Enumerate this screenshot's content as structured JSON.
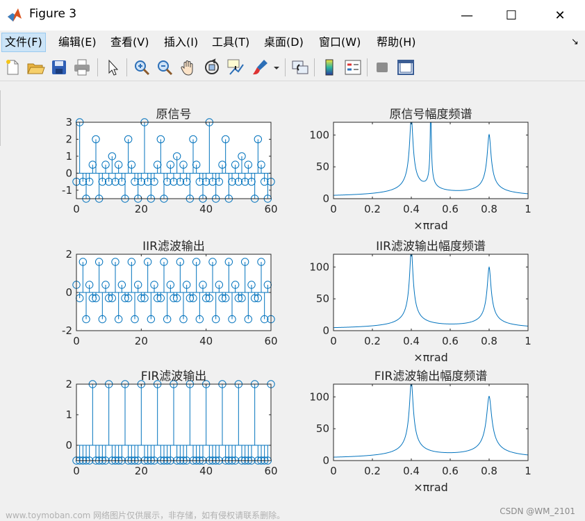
{
  "window": {
    "title": "Figure 3",
    "controls": {
      "minimize": "—",
      "maximize": "☐",
      "close": "✕"
    }
  },
  "menu": [
    {
      "label": "文件(F)",
      "active": true
    },
    {
      "label": "编辑(E)"
    },
    {
      "label": "查看(V)"
    },
    {
      "label": "插入(I)"
    },
    {
      "label": "工具(T)"
    },
    {
      "label": "桌面(D)"
    },
    {
      "label": "窗口(W)"
    },
    {
      "label": "帮助(H)"
    }
  ],
  "menu_dock_glyph": "↘",
  "toolbar": [
    "new-figure-icon",
    "open-file-icon",
    "save-icon",
    "print-icon",
    "pointer-icon",
    "zoom-in-icon",
    "zoom-out-icon",
    "pan-hand-icon",
    "rotate-3d-icon",
    "data-cursor-icon",
    "brush-icon",
    "link-plot-icon",
    "colorbar-icon",
    "legend-icon",
    "hide-plot-tools-icon",
    "show-plot-tools-icon"
  ],
  "colors": {
    "line": "#0072bd",
    "axes": "#262626",
    "plot_bg": "#ffffff",
    "figure_bg": "#f0f0f0"
  },
  "chart_data": [
    {
      "type": "stem",
      "title": "原信号",
      "xlabel": "",
      "ylabel": "",
      "xlim": [
        0,
        60
      ],
      "ylim": [
        -1.5,
        3
      ],
      "xticks": [
        0,
        20,
        40,
        60
      ],
      "yticks": [
        -1,
        0,
        1,
        2,
        3
      ],
      "x": [
        0,
        1,
        2,
        3,
        4,
        5,
        6,
        7,
        8,
        9,
        10,
        11,
        12,
        13,
        14,
        15,
        16,
        17,
        18,
        19,
        20,
        21,
        22,
        23,
        24,
        25,
        26,
        27,
        28,
        29,
        30,
        31,
        32,
        33,
        34,
        35,
        36,
        37,
        38,
        39,
        40,
        41,
        42,
        43,
        44,
        45,
        46,
        47,
        48,
        49,
        50,
        51,
        52,
        53,
        54,
        55,
        56,
        57,
        58,
        59,
        60
      ],
      "values": [
        -0.5,
        3,
        -0.5,
        -1.5,
        -0.5,
        0.5,
        2,
        -1.5,
        -0.5,
        0.5,
        -0.5,
        1,
        -0.5,
        0.5,
        -0.5,
        -1.5,
        2,
        0.5,
        -0.5,
        -1.5,
        -0.5,
        3,
        -0.5,
        -1.5,
        -0.5,
        0.5,
        2,
        -1.5,
        -0.5,
        0.5,
        -0.5,
        1,
        -0.5,
        0.5,
        -0.5,
        -1.5,
        2,
        0.5,
        -0.5,
        -1.5,
        -0.5,
        3,
        -0.5,
        -1.5,
        -0.5,
        0.5,
        2,
        -1.5,
        -0.5,
        0.5,
        -0.5,
        1,
        -0.5,
        0.5,
        -0.5,
        -1.5,
        2,
        0.5,
        -0.5,
        -1.5,
        -0.5
      ]
    },
    {
      "type": "line",
      "title": "原信号幅度频谱",
      "xlabel": "×πrad",
      "ylabel": "",
      "xlim": [
        0,
        1
      ],
      "ylim": [
        0,
        120
      ],
      "xticks": [
        0,
        0.2,
        0.4,
        0.6,
        0.8,
        1
      ],
      "yticks": [
        0,
        50,
        100
      ],
      "peaks": [
        {
          "x": 0.4,
          "y": 122,
          "width": 0.008
        },
        {
          "x": 0.5,
          "y": 150,
          "width": 0.002
        },
        {
          "x": 0.8,
          "y": 96,
          "width": 0.009
        }
      ]
    },
    {
      "type": "stem",
      "title": "IIR滤波输出",
      "xlabel": "",
      "ylabel": "",
      "xlim": [
        0,
        60
      ],
      "ylim": [
        -2,
        2
      ],
      "xticks": [
        0,
        20,
        40,
        60
      ],
      "yticks": [
        -2,
        0,
        2
      ],
      "x": [
        0,
        1,
        2,
        3,
        4,
        5,
        6,
        7,
        8,
        9,
        10,
        11,
        12,
        13,
        14,
        15,
        16,
        17,
        18,
        19,
        20,
        21,
        22,
        23,
        24,
        25,
        26,
        27,
        28,
        29,
        30,
        31,
        32,
        33,
        34,
        35,
        36,
        37,
        38,
        39,
        40,
        41,
        42,
        43,
        44,
        45,
        46,
        47,
        48,
        49,
        50,
        51,
        52,
        53,
        54,
        55,
        56,
        57,
        58,
        59,
        60
      ],
      "values": [
        0.4,
        -0.3,
        1.6,
        -1.4,
        0.4,
        -0.3,
        -0.3,
        1.6,
        -1.4,
        0.4,
        -0.3,
        -0.3,
        1.6,
        -1.4,
        0.4,
        -0.3,
        -0.3,
        1.6,
        -1.4,
        0.4,
        -0.3,
        -0.3,
        1.6,
        -1.4,
        0.4,
        -0.3,
        -0.3,
        1.6,
        -1.4,
        0.4,
        -0.3,
        -0.3,
        1.6,
        -1.4,
        0.4,
        -0.3,
        -0.3,
        1.6,
        -1.4,
        0.4,
        -0.3,
        -0.3,
        1.6,
        -1.4,
        0.4,
        -0.3,
        -0.3,
        1.6,
        -1.4,
        0.4,
        -0.3,
        -0.3,
        1.6,
        -1.4,
        0.4,
        -0.3,
        -0.3,
        1.6,
        -1.4,
        0.4,
        -1.4
      ]
    },
    {
      "type": "line",
      "title": "IIR滤波输出幅度频谱",
      "xlabel": "×πrad",
      "ylabel": "",
      "xlim": [
        0,
        1
      ],
      "ylim": [
        0,
        120
      ],
      "xticks": [
        0,
        0.2,
        0.4,
        0.6,
        0.8,
        1
      ],
      "yticks": [
        0,
        50,
        100
      ],
      "peaks": [
        {
          "x": 0.4,
          "y": 125,
          "width": 0.008
        },
        {
          "x": 0.8,
          "y": 96,
          "width": 0.009
        }
      ]
    },
    {
      "type": "stem",
      "title": "FIR滤波输出",
      "xlabel": "",
      "ylabel": "",
      "xlim": [
        0,
        60
      ],
      "ylim": [
        -0.5,
        2
      ],
      "xticks": [
        0,
        20,
        40,
        60
      ],
      "yticks": [
        0,
        1,
        2
      ],
      "x": [
        0,
        1,
        2,
        3,
        4,
        5,
        6,
        7,
        8,
        9,
        10,
        11,
        12,
        13,
        14,
        15,
        16,
        17,
        18,
        19,
        20,
        21,
        22,
        23,
        24,
        25,
        26,
        27,
        28,
        29,
        30,
        31,
        32,
        33,
        34,
        35,
        36,
        37,
        38,
        39,
        40,
        41,
        42,
        43,
        44,
        45,
        46,
        47,
        48,
        49,
        50,
        51,
        52,
        53,
        54,
        55,
        56,
        57,
        58,
        59,
        60
      ],
      "values": [
        -0.5,
        -0.5,
        -0.5,
        -0.5,
        -0.5,
        2,
        -0.5,
        -0.5,
        -0.5,
        -0.5,
        2,
        -0.5,
        -0.5,
        -0.5,
        -0.5,
        2,
        -0.5,
        -0.5,
        -0.5,
        -0.5,
        2,
        -0.5,
        -0.5,
        -0.5,
        -0.5,
        2,
        -0.5,
        -0.5,
        -0.5,
        -0.5,
        2,
        -0.5,
        -0.5,
        -0.5,
        -0.5,
        2,
        -0.5,
        -0.5,
        -0.5,
        -0.5,
        2,
        -0.5,
        -0.5,
        -0.5,
        -0.5,
        2,
        -0.5,
        -0.5,
        -0.5,
        -0.5,
        2,
        -0.5,
        -0.5,
        -0.5,
        -0.5,
        2,
        -0.5,
        -0.5,
        -0.5,
        -0.5,
        2
      ]
    },
    {
      "type": "line",
      "title": "FIR滤波输出幅度频谱",
      "xlabel": "×πrad",
      "ylabel": "",
      "xlim": [
        0,
        1
      ],
      "ylim": [
        0,
        120
      ],
      "xticks": [
        0,
        0.2,
        0.4,
        0.6,
        0.8,
        1
      ],
      "yticks": [
        0,
        50,
        100
      ],
      "peaks": [
        {
          "x": 0.4,
          "y": 120,
          "width": 0.009
        },
        {
          "x": 0.8,
          "y": 97,
          "width": 0.012
        }
      ]
    }
  ],
  "watermarks": {
    "left": "www.toymoban.com 网络图片仅供展示，非存储，如有侵权请联系删除。",
    "right": "CSDN @WM_2101"
  }
}
